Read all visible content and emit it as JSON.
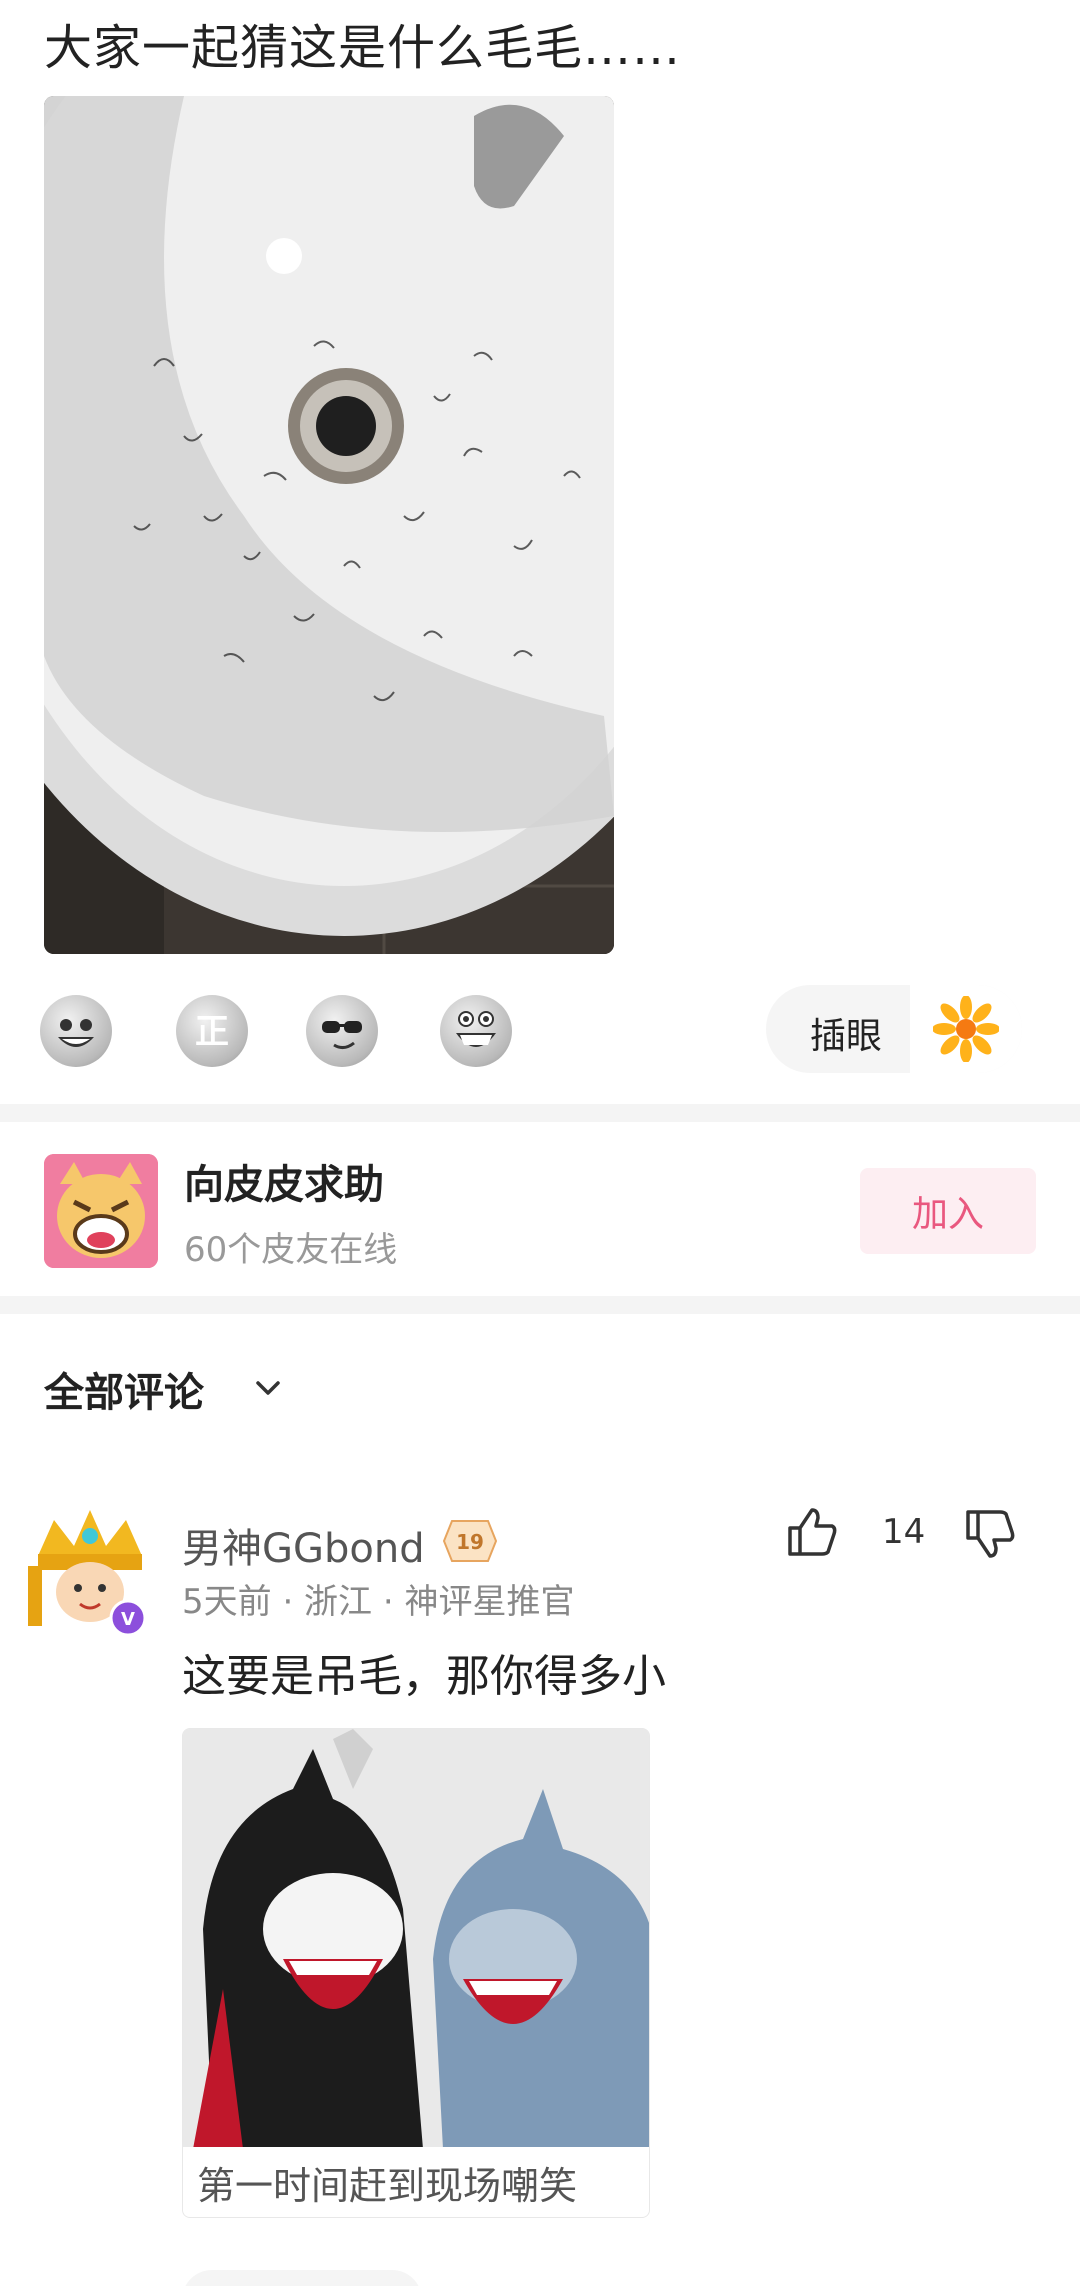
{
  "post": {
    "title": "大家一起猜这是什么毛毛……"
  },
  "reactions": {
    "items": [
      "laugh-emoji",
      "zheng-emoji",
      "sunglasses-emoji",
      "grin-emoji"
    ],
    "insert_label": "插眼"
  },
  "group": {
    "name": "向皮皮求助",
    "online": "60个皮友在线",
    "join_label": "加入"
  },
  "comments_section": {
    "title": "全部评论"
  },
  "comment": {
    "username": "男神GGbond",
    "level": "19",
    "meta": "5天前 · 浙江 · 神评星推官",
    "text": "这要是吊毛，那你得多小",
    "likes": "14",
    "meme_caption": "第一时间赶到现场嘲笑"
  },
  "colors": {
    "accent": "#e9587f",
    "join_bg": "#fdeef2",
    "divider": "#f4f4f4"
  }
}
